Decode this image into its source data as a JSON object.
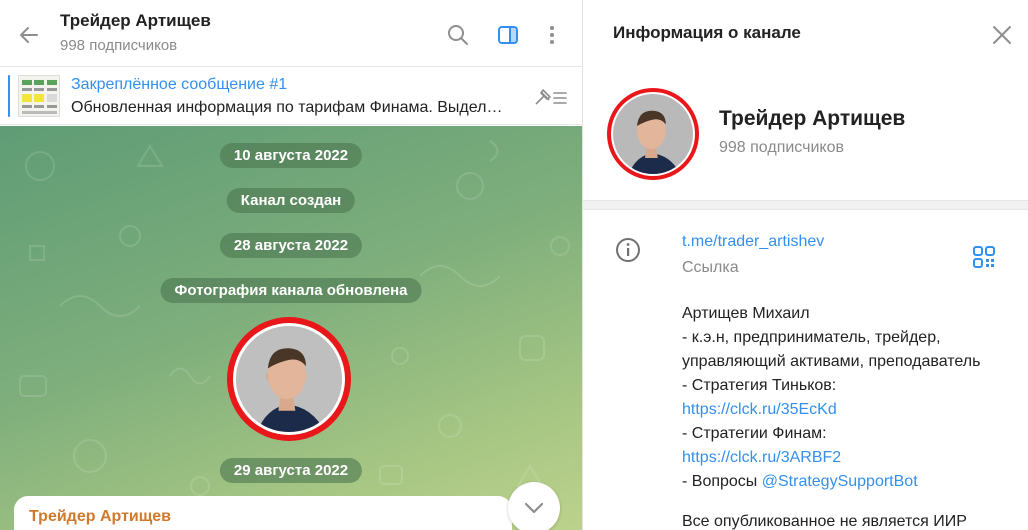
{
  "chat": {
    "title": "Трейдер Артищев",
    "subtitle": "998 подписчиков",
    "pinned_title": "Закреплённое сообщение #1",
    "pinned_text": "Обновленная информация по тарифам Финама. Выделяем в комментариях и ниже",
    "service_messages": [
      "10 августа 2022",
      "Канал создан",
      "28 августа 2022",
      "Фотография канала обновлена",
      "29 августа 2022"
    ],
    "message_author": "Трейдер Артищев"
  },
  "info": {
    "title": "Информация о канале",
    "name": "Трейдер Артищев",
    "subscribers": "998 подписчиков",
    "link": "t.me/trader_artishev",
    "link_caption": "Ссылка",
    "desc_lines": [
      "Артищев Михаил",
      "- к.э.н, предприниматель, трейдер,",
      "управляющий активами, преподаватель",
      "- Стратегия Тиньков:",
      "https://clck.ru/35EcKd",
      "- Стратегии Финам:",
      "https://clck.ru/3ARBF2",
      "- Вопросы ",
      "@StrategySupportBot",
      "Все опубликованное не является ИИР"
    ]
  },
  "icons": {
    "back": "arrow-left-icon",
    "search": "search-icon",
    "sidebar": "sidebar-toggle-icon",
    "more": "more-vertical-icon",
    "unpin": "unpin-list-icon",
    "scroll": "chevron-down-icon",
    "close": "close-icon",
    "info": "info-circle-icon",
    "qr": "qr-code-icon"
  },
  "colors": {
    "accent": "#3390ec",
    "avatar_ring": "#e9171a",
    "author": "#d1792a",
    "chat_bg": "#7eae7c"
  }
}
